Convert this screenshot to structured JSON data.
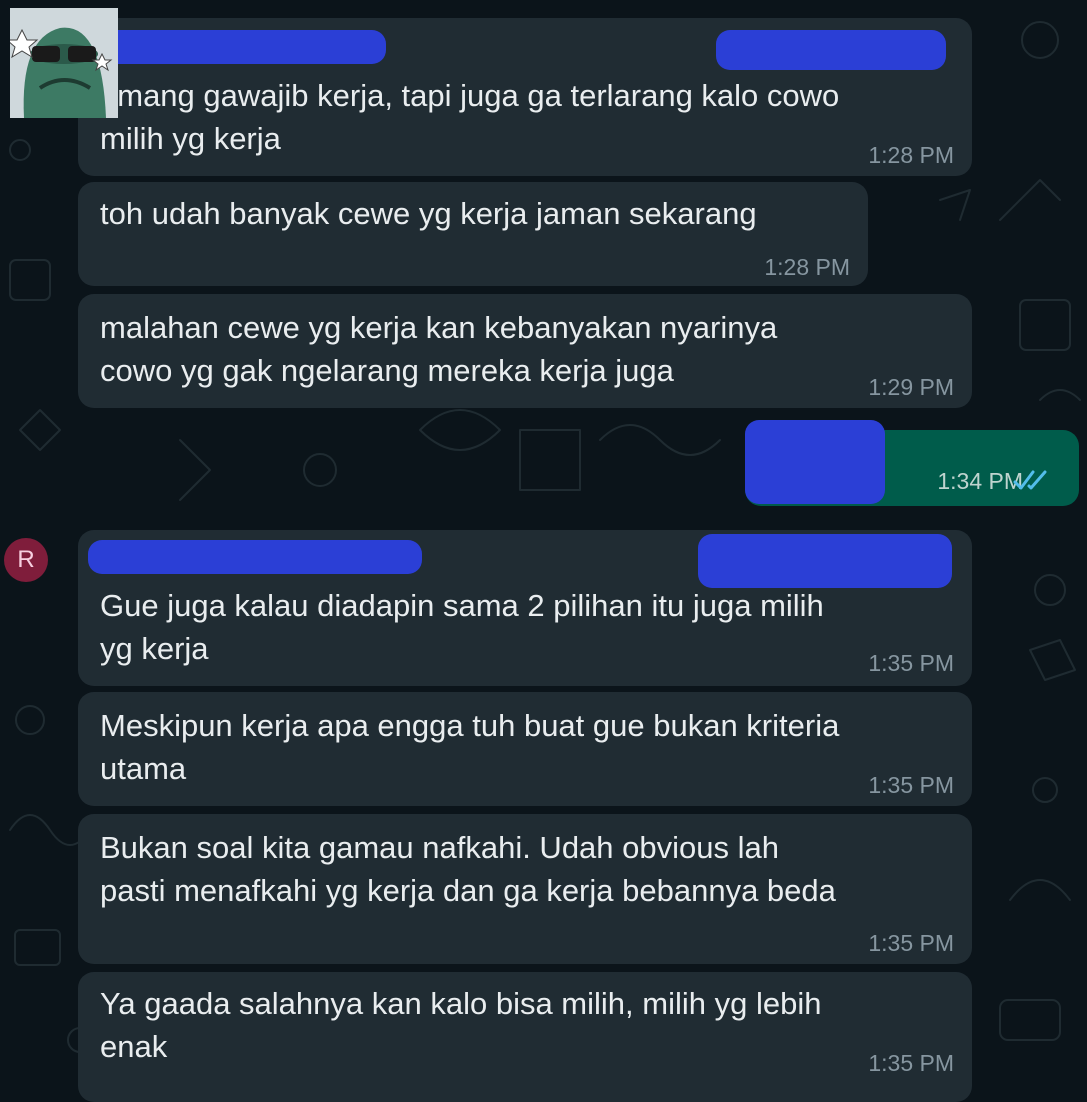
{
  "messages": [
    {
      "text": "emang gawajib kerja, tapi juga ga terlarang kalo cowo\nmilih yg kerja",
      "time": "1:28 PM"
    },
    {
      "text": "toh udah banyak cewe yg kerja jaman sekarang",
      "time": "1:28 PM"
    },
    {
      "text": "malahan cewe yg kerja kan kebanyakan nyarinya\ncowo yg gak ngelarang mereka kerja juga",
      "time": "1:29 PM"
    },
    {
      "text": "",
      "time": "1:34 PM",
      "status": "read-double-check"
    },
    {
      "text": "Gue juga kalau diadapin sama 2 pilihan itu juga milih\nyg kerja",
      "time": "1:35 PM"
    },
    {
      "text": "Meskipun kerja apa engga tuh buat gue bukan kriteria\nutama",
      "time": "1:35 PM"
    },
    {
      "text": "Bukan soal kita gamau nafkahi. Udah obvious lah\npasti menafkahi yg kerja dan ga kerja bebannya beda",
      "time": "1:35 PM"
    },
    {
      "text": "Ya gaada salahnya kan kalo bisa milih, milih yg lebih\nenak",
      "time": "1:35 PM"
    }
  ],
  "sender_avatar": {
    "letter": "R",
    "color": "#7f1d3b"
  },
  "colors": {
    "background": "#0b141a",
    "incoming_bubble": "#202c33",
    "outgoing_bubble": "#005c4b",
    "redaction": "#2b3fd6",
    "read_ticks": "#53bdeb"
  },
  "icons": [
    "sticker-avatar-icon",
    "double-check-icon"
  ]
}
